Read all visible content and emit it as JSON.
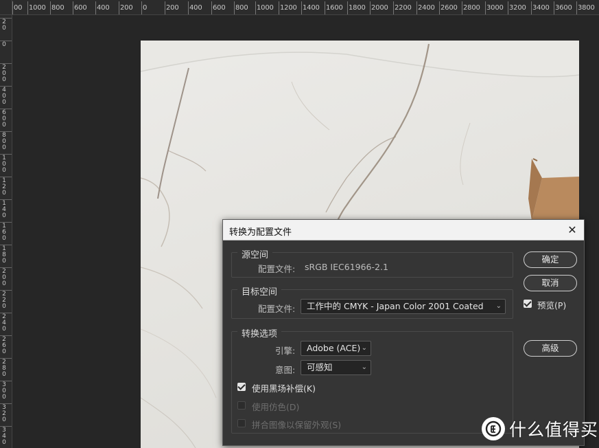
{
  "rulers": {
    "horizontal_labels": [
      "00",
      "1000",
      "800",
      "600",
      "400",
      "200",
      "0",
      "200",
      "400",
      "600",
      "800",
      "1000",
      "1200",
      "1400",
      "1600",
      "1800",
      "2000",
      "2200",
      "2400",
      "2600",
      "2800",
      "3000",
      "3200",
      "3400",
      "3600",
      "3800"
    ],
    "vertical_labels": [
      "2 0",
      "0",
      "2 0 0",
      "4 0 0",
      "6 0 0",
      "8 0 0",
      "1 0 0",
      "1 2 0",
      "1 4 0",
      "1 6 0",
      "1 8 0",
      "2 0 0",
      "2 2 0",
      "2 4 0",
      "2 6 0",
      "2 8 0",
      "3 0 0",
      "3 2 0",
      "3 4 0"
    ]
  },
  "dialog": {
    "title": "转换为配置文件",
    "source_space": {
      "legend": "源空间",
      "profile_label": "配置文件:",
      "profile_value": "sRGB IEC61966-2.1"
    },
    "target_space": {
      "legend": "目标空间",
      "profile_label": "配置文件:",
      "profile_value": "工作中的 CMYK - Japan Color 2001 Coated"
    },
    "conversion_options": {
      "legend": "转换选项",
      "engine_label": "引擎:",
      "engine_value": "Adobe (ACE)",
      "intent_label": "意图:",
      "intent_value": "可感知",
      "black_point_label": "使用黑场补偿(K)",
      "black_point_checked": true,
      "dither_label": "使用仿色(D)",
      "dither_checked": false,
      "flatten_label": "拼合图像以保留外观(S)",
      "flatten_checked": false
    },
    "buttons": {
      "ok": "确定",
      "cancel": "取消",
      "advanced": "高级"
    },
    "preview_label": "预览(P)",
    "preview_checked": true
  },
  "watermark": {
    "logo_glyph": "值",
    "text": "什么值得买"
  },
  "colors": {
    "accent": "#e6e6e6",
    "dialog_bg": "#353535",
    "titlebar_bg": "#f2f2f2"
  }
}
